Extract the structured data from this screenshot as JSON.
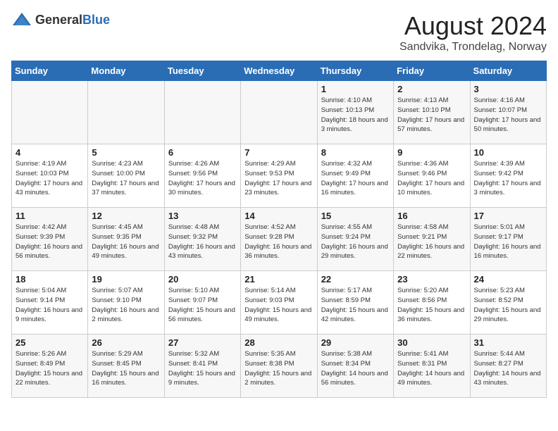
{
  "header": {
    "logo_general": "General",
    "logo_blue": "Blue",
    "month_title": "August 2024",
    "location": "Sandvika, Trondelag, Norway"
  },
  "weekdays": [
    "Sunday",
    "Monday",
    "Tuesday",
    "Wednesday",
    "Thursday",
    "Friday",
    "Saturday"
  ],
  "weeks": [
    [
      {
        "day": "",
        "sunrise": "",
        "sunset": "",
        "daylight": ""
      },
      {
        "day": "",
        "sunrise": "",
        "sunset": "",
        "daylight": ""
      },
      {
        "day": "",
        "sunrise": "",
        "sunset": "",
        "daylight": ""
      },
      {
        "day": "",
        "sunrise": "",
        "sunset": "",
        "daylight": ""
      },
      {
        "day": "1",
        "sunrise": "Sunrise: 4:10 AM",
        "sunset": "Sunset: 10:13 PM",
        "daylight": "Daylight: 18 hours and 3 minutes."
      },
      {
        "day": "2",
        "sunrise": "Sunrise: 4:13 AM",
        "sunset": "Sunset: 10:10 PM",
        "daylight": "Daylight: 17 hours and 57 minutes."
      },
      {
        "day": "3",
        "sunrise": "Sunrise: 4:16 AM",
        "sunset": "Sunset: 10:07 PM",
        "daylight": "Daylight: 17 hours and 50 minutes."
      }
    ],
    [
      {
        "day": "4",
        "sunrise": "Sunrise: 4:19 AM",
        "sunset": "Sunset: 10:03 PM",
        "daylight": "Daylight: 17 hours and 43 minutes."
      },
      {
        "day": "5",
        "sunrise": "Sunrise: 4:23 AM",
        "sunset": "Sunset: 10:00 PM",
        "daylight": "Daylight: 17 hours and 37 minutes."
      },
      {
        "day": "6",
        "sunrise": "Sunrise: 4:26 AM",
        "sunset": "Sunset: 9:56 PM",
        "daylight": "Daylight: 17 hours and 30 minutes."
      },
      {
        "day": "7",
        "sunrise": "Sunrise: 4:29 AM",
        "sunset": "Sunset: 9:53 PM",
        "daylight": "Daylight: 17 hours and 23 minutes."
      },
      {
        "day": "8",
        "sunrise": "Sunrise: 4:32 AM",
        "sunset": "Sunset: 9:49 PM",
        "daylight": "Daylight: 17 hours and 16 minutes."
      },
      {
        "day": "9",
        "sunrise": "Sunrise: 4:36 AM",
        "sunset": "Sunset: 9:46 PM",
        "daylight": "Daylight: 17 hours and 10 minutes."
      },
      {
        "day": "10",
        "sunrise": "Sunrise: 4:39 AM",
        "sunset": "Sunset: 9:42 PM",
        "daylight": "Daylight: 17 hours and 3 minutes."
      }
    ],
    [
      {
        "day": "11",
        "sunrise": "Sunrise: 4:42 AM",
        "sunset": "Sunset: 9:39 PM",
        "daylight": "Daylight: 16 hours and 56 minutes."
      },
      {
        "day": "12",
        "sunrise": "Sunrise: 4:45 AM",
        "sunset": "Sunset: 9:35 PM",
        "daylight": "Daylight: 16 hours and 49 minutes."
      },
      {
        "day": "13",
        "sunrise": "Sunrise: 4:48 AM",
        "sunset": "Sunset: 9:32 PM",
        "daylight": "Daylight: 16 hours and 43 minutes."
      },
      {
        "day": "14",
        "sunrise": "Sunrise: 4:52 AM",
        "sunset": "Sunset: 9:28 PM",
        "daylight": "Daylight: 16 hours and 36 minutes."
      },
      {
        "day": "15",
        "sunrise": "Sunrise: 4:55 AM",
        "sunset": "Sunset: 9:24 PM",
        "daylight": "Daylight: 16 hours and 29 minutes."
      },
      {
        "day": "16",
        "sunrise": "Sunrise: 4:58 AM",
        "sunset": "Sunset: 9:21 PM",
        "daylight": "Daylight: 16 hours and 22 minutes."
      },
      {
        "day": "17",
        "sunrise": "Sunrise: 5:01 AM",
        "sunset": "Sunset: 9:17 PM",
        "daylight": "Daylight: 16 hours and 16 minutes."
      }
    ],
    [
      {
        "day": "18",
        "sunrise": "Sunrise: 5:04 AM",
        "sunset": "Sunset: 9:14 PM",
        "daylight": "Daylight: 16 hours and 9 minutes."
      },
      {
        "day": "19",
        "sunrise": "Sunrise: 5:07 AM",
        "sunset": "Sunset: 9:10 PM",
        "daylight": "Daylight: 16 hours and 2 minutes."
      },
      {
        "day": "20",
        "sunrise": "Sunrise: 5:10 AM",
        "sunset": "Sunset: 9:07 PM",
        "daylight": "Daylight: 15 hours and 56 minutes."
      },
      {
        "day": "21",
        "sunrise": "Sunrise: 5:14 AM",
        "sunset": "Sunset: 9:03 PM",
        "daylight": "Daylight: 15 hours and 49 minutes."
      },
      {
        "day": "22",
        "sunrise": "Sunrise: 5:17 AM",
        "sunset": "Sunset: 8:59 PM",
        "daylight": "Daylight: 15 hours and 42 minutes."
      },
      {
        "day": "23",
        "sunrise": "Sunrise: 5:20 AM",
        "sunset": "Sunset: 8:56 PM",
        "daylight": "Daylight: 15 hours and 36 minutes."
      },
      {
        "day": "24",
        "sunrise": "Sunrise: 5:23 AM",
        "sunset": "Sunset: 8:52 PM",
        "daylight": "Daylight: 15 hours and 29 minutes."
      }
    ],
    [
      {
        "day": "25",
        "sunrise": "Sunrise: 5:26 AM",
        "sunset": "Sunset: 8:49 PM",
        "daylight": "Daylight: 15 hours and 22 minutes."
      },
      {
        "day": "26",
        "sunrise": "Sunrise: 5:29 AM",
        "sunset": "Sunset: 8:45 PM",
        "daylight": "Daylight: 15 hours and 16 minutes."
      },
      {
        "day": "27",
        "sunrise": "Sunrise: 5:32 AM",
        "sunset": "Sunset: 8:41 PM",
        "daylight": "Daylight: 15 hours and 9 minutes."
      },
      {
        "day": "28",
        "sunrise": "Sunrise: 5:35 AM",
        "sunset": "Sunset: 8:38 PM",
        "daylight": "Daylight: 15 hours and 2 minutes."
      },
      {
        "day": "29",
        "sunrise": "Sunrise: 5:38 AM",
        "sunset": "Sunset: 8:34 PM",
        "daylight": "Daylight: 14 hours and 56 minutes."
      },
      {
        "day": "30",
        "sunrise": "Sunrise: 5:41 AM",
        "sunset": "Sunset: 8:31 PM",
        "daylight": "Daylight: 14 hours and 49 minutes."
      },
      {
        "day": "31",
        "sunrise": "Sunrise: 5:44 AM",
        "sunset": "Sunset: 8:27 PM",
        "daylight": "Daylight: 14 hours and 43 minutes."
      }
    ]
  ]
}
